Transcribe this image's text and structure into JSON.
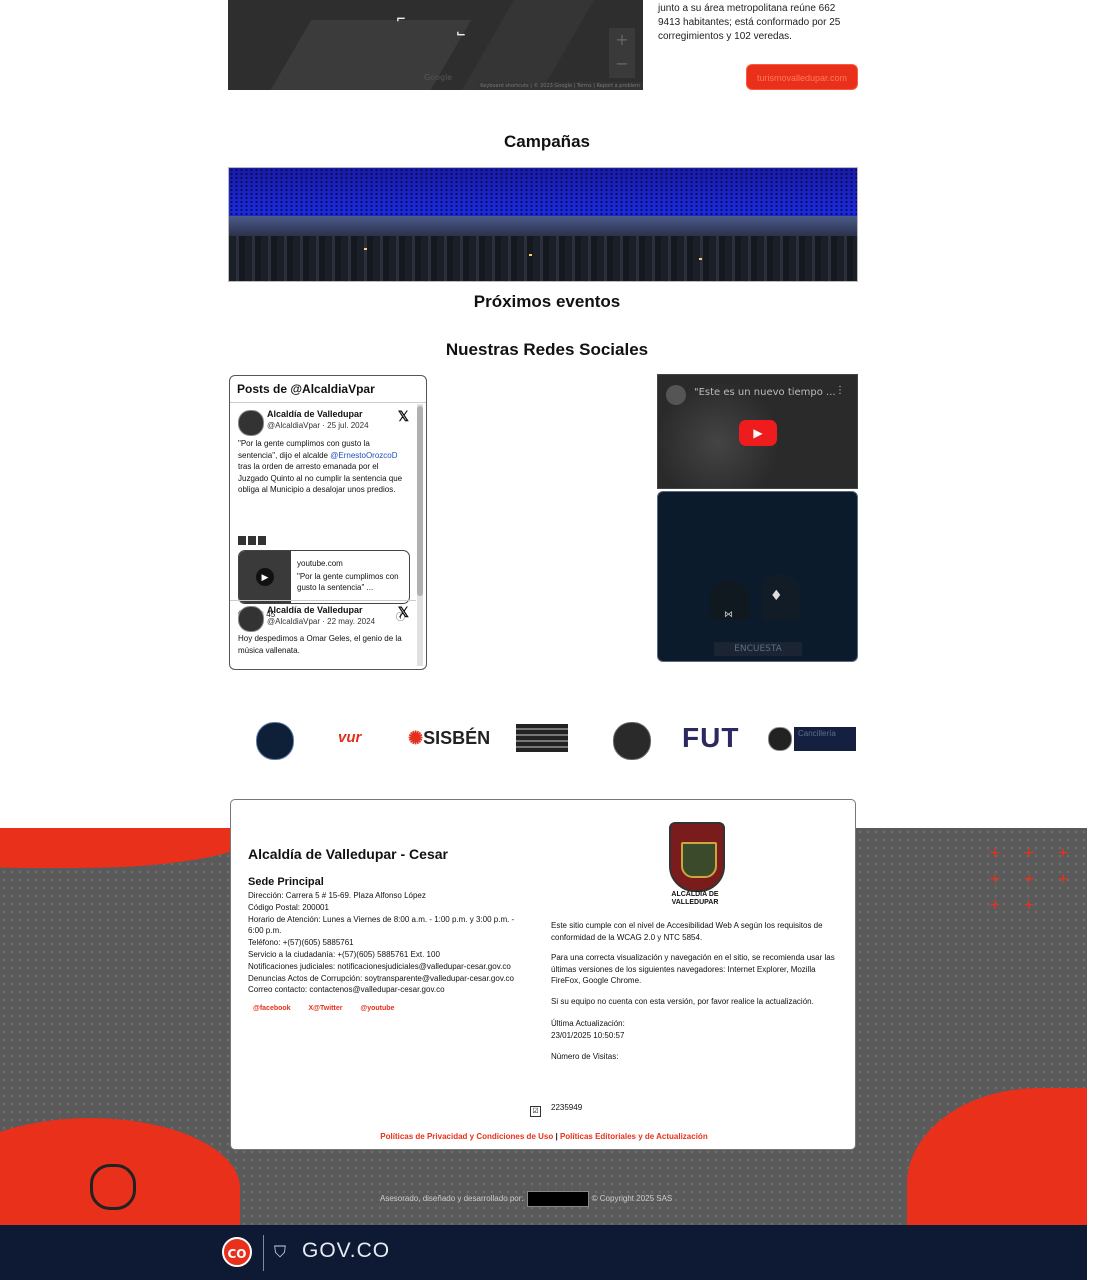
{
  "map": {
    "google_label": "Google",
    "zoom_in": "+",
    "zoom_out": "−",
    "attribution": "Keyboard shortcuts  |  © 2023 Google  |  Terms  |  Report a problem"
  },
  "intro": {
    "text": "junto a su área metropolitana reúne 662 9413 habitantes; está conformado por 25 corregimientos y 102 veredas.",
    "turismo_button": "turismovalledupar.com"
  },
  "sections": {
    "campaigns": "Campañas",
    "events": "Próximos eventos",
    "social": "Nuestras Redes Sociales"
  },
  "twitter": {
    "header": "Posts de @AlcaldiaVpar",
    "tweets": [
      {
        "name": "Alcaldía de Valledupar",
        "handle": "@AlcaldiaVpar · 25 jul. 2024",
        "text": "\"Por la gente cumplimos con gusto la sentencia\", dijo el alcalde",
        "mention": "@ErnestoOrozcoD",
        "text2": "tras la orden de arresto emanada por el Juzgado Quinto al no cumplir la sentencia que obliga al Municipio a desalojar unos predios.",
        "card_domain": "youtube.com",
        "card_title": "\"Por la gente cumplimos con gusto la sentencia\" ...",
        "actions": "💬 8  ♡ 45"
      },
      {
        "name": "Alcaldía de Valledupar",
        "handle": "@AlcaldiaVpar · 22 may. 2024",
        "text": "Hoy despedimos a Omar Geles, el genio de la música vallenata."
      }
    ]
  },
  "youtube": {
    "title": "\"Este es un nuevo tiempo ...",
    "menu": "⋮",
    "play": "▶"
  },
  "survey": {
    "label": "ENCUESTA"
  },
  "logos": {
    "vur": "vur",
    "sisben_prefix": "✺",
    "sisben": "SISBÉN",
    "fut": "FUT",
    "cancilleria": "Cancillería"
  },
  "footer": {
    "org_title": "Alcaldía de Valledupar - Cesar",
    "sede": "Sede Principal",
    "lines": [
      "Dirección: Carrera 5 # 15-69. Plaza Alfonso López",
      "Código Postal: 200001",
      "Horario de Atención: Lunes a Viernes de 8:00 a.m. - 1:00 p.m. y 3:00 p.m. - 6:00 p.m.",
      "Teléfono: +(57)(605) 5885761",
      "Servicio a la ciudadanía: +(57)(605) 5885761 Ext. 100",
      "Notificaciones judiciales: notificacionesjudiciales@valledupar-cesar.gov.co",
      "Denuncias Actos de Corrupción: soytransparente@valledupar-cesar.gov.co",
      "Correo contacto: contactenos@valledupar-cesar.gov.co"
    ],
    "social": [
      "@facebook",
      "X@Twitter",
      "@youtube"
    ],
    "crest_name": "ALCALDÍA DE VALLEDUPAR",
    "accessibility": "Este sitio cumple con el nivel de Accesibilidad Web A según los requisitos de conformidad de la WCAG 2.0 y NTC 5854.",
    "browsers": "Para una correcta visualización y navegación en el sitio, se recomienda usar las últimas versiones de los siguientes navegadores: Internet Explorer, Mozilla FireFox, Google Chrome.",
    "update_note": "Si su equipo no cuenta con esta versión, por favor realice la actualización.",
    "last_update_label": "Última Actualización:",
    "last_update": "23/01/2025 10:50:57",
    "visits_label": "Número de Visitas:",
    "visits": "2235949",
    "privacy_link": "Políticas de Privacidad y Condiciones de Uso",
    "separator": "|",
    "editorial_link": "Políticas Editoriales y de Actualización",
    "credit_prefix": "Asesorado, diseñado y desarrollado por:",
    "credit_suffix": "© Copyright 2025 SAS"
  },
  "govbar": {
    "co": "CO",
    "label": "GOV.CO"
  }
}
